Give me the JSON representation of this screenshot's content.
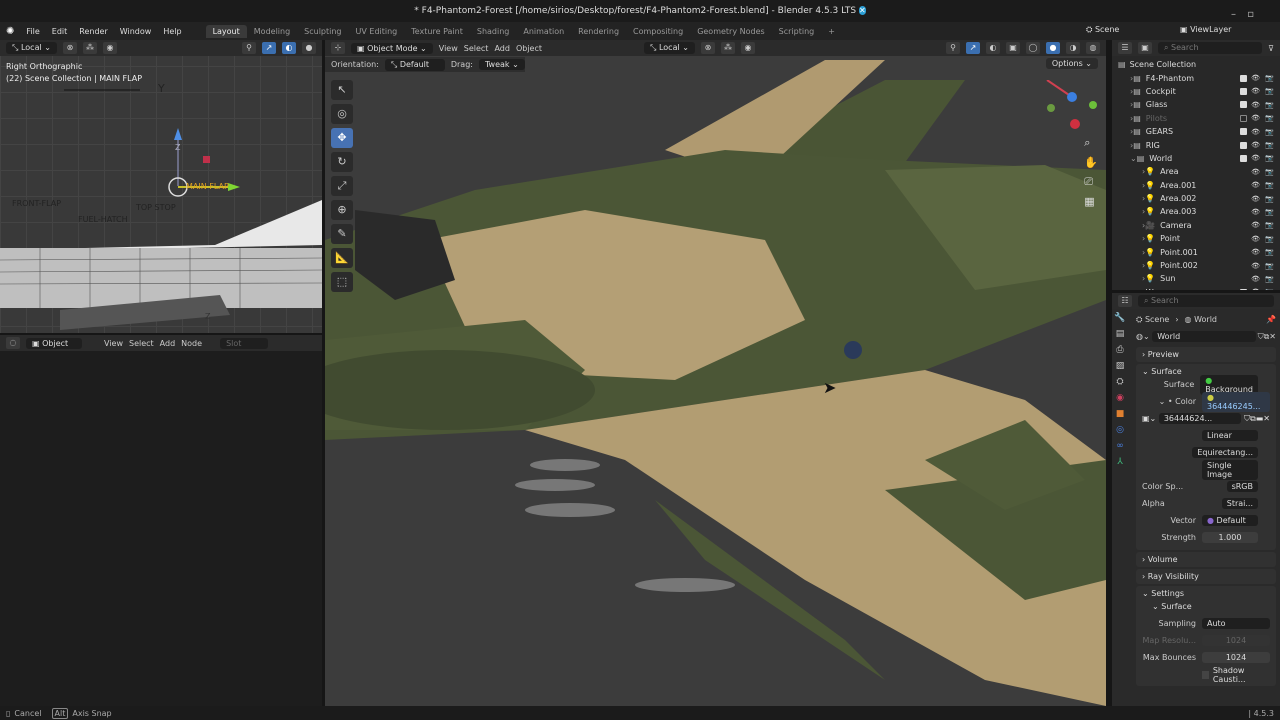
{
  "window": {
    "title": "* F4-Phantom2-Forest [/home/sirios/Desktop/forest/F4-Phantom2-Forest.blend] - Blender 4.5.3 LTS",
    "min": "–",
    "max": "▫",
    "close": "✕"
  },
  "menu": [
    "File",
    "Edit",
    "Render",
    "Window",
    "Help"
  ],
  "workspaces": [
    "Layout",
    "Modeling",
    "Sculpting",
    "UV Editing",
    "Texture Paint",
    "Shading",
    "Animation",
    "Rendering",
    "Compositing",
    "Geometry Nodes",
    "Scripting",
    "+"
  ],
  "topright": {
    "scene": "Scene",
    "viewlayer": "ViewLayer"
  },
  "left_view": {
    "transform": "Local",
    "view_name": "Right Orthographic",
    "collection": "(22) Scene Collection | MAIN FLAP",
    "labels": [
      "MAIN FLAP",
      "FRONT-FLAP",
      "FUEL-HATCH",
      "TOP STOP",
      "Z",
      "Y",
      "Z"
    ]
  },
  "node_editor": {
    "mode": "Object",
    "menu": [
      "View",
      "Select",
      "Add",
      "Node"
    ],
    "slot": "Slot"
  },
  "main_view": {
    "mode": "Object Mode",
    "menu": [
      "View",
      "Select",
      "Add",
      "Object"
    ],
    "transform": "Local",
    "orientation_label": "Orientation:",
    "orientation": "Default",
    "drag_label": "Drag:",
    "drag": "Tweak",
    "options": "Options"
  },
  "outliner": {
    "search_placeholder": "Search",
    "root": "Scene Collection",
    "items": [
      {
        "name": "F4-Phantom",
        "level": 0,
        "type": "collection",
        "checked": true
      },
      {
        "name": "Cockpit",
        "level": 0,
        "type": "collection",
        "checked": true
      },
      {
        "name": "Glass",
        "level": 0,
        "type": "collection",
        "checked": true
      },
      {
        "name": "Pilots",
        "level": 0,
        "type": "collection",
        "checked": false
      },
      {
        "name": "GEARS",
        "level": 0,
        "type": "collection",
        "checked": true
      },
      {
        "name": "RIG",
        "level": 0,
        "type": "collection",
        "checked": true
      },
      {
        "name": "World",
        "level": 0,
        "type": "collection",
        "checked": true,
        "expanded": true
      },
      {
        "name": "Area",
        "level": 1,
        "type": "light"
      },
      {
        "name": "Area.001",
        "level": 1,
        "type": "light"
      },
      {
        "name": "Area.002",
        "level": 1,
        "type": "light"
      },
      {
        "name": "Area.003",
        "level": 1,
        "type": "light"
      },
      {
        "name": "Camera",
        "level": 1,
        "type": "camera"
      },
      {
        "name": "Point",
        "level": 1,
        "type": "light"
      },
      {
        "name": "Point.001",
        "level": 1,
        "type": "light"
      },
      {
        "name": "Point.002",
        "level": 1,
        "type": "light"
      },
      {
        "name": "Sun",
        "level": 1,
        "type": "light"
      },
      {
        "name": "Weapons",
        "level": 0,
        "type": "collection",
        "checked": true
      }
    ]
  },
  "properties": {
    "search_placeholder": "Search",
    "breadcrumb": [
      "Scene",
      "World"
    ],
    "world_name": "World",
    "preview": "Preview",
    "surface_panel": "Surface",
    "surface_label": "Surface",
    "surface_value": "Background",
    "color_label": "Color",
    "color_value": "364446245...",
    "image_name": "36444624...",
    "interp": "Linear",
    "projection": "Equirectang...",
    "source": "Single Image",
    "colorspace_label": "Color Sp...",
    "colorspace": "sRGB",
    "alpha_label": "Alpha",
    "alpha": "Strai...",
    "vector_label": "Vector",
    "vector": "Default",
    "strength_label": "Strength",
    "strength": "1.000",
    "volume": "Volume",
    "ray_visibility": "Ray Visibility",
    "settings": "Settings",
    "settings_surface": "Surface",
    "sampling_label": "Sampling",
    "sampling": "Auto",
    "mapres_label": "Map Resolu...",
    "mapres": "1024",
    "bounces_label": "Max Bounces",
    "bounces": "1024",
    "shadow": "Shadow Causti..."
  },
  "status": {
    "cancel": "Cancel",
    "alt_key": "Alt",
    "axis_snap": "Axis Snap",
    "version": "4.5.3"
  }
}
